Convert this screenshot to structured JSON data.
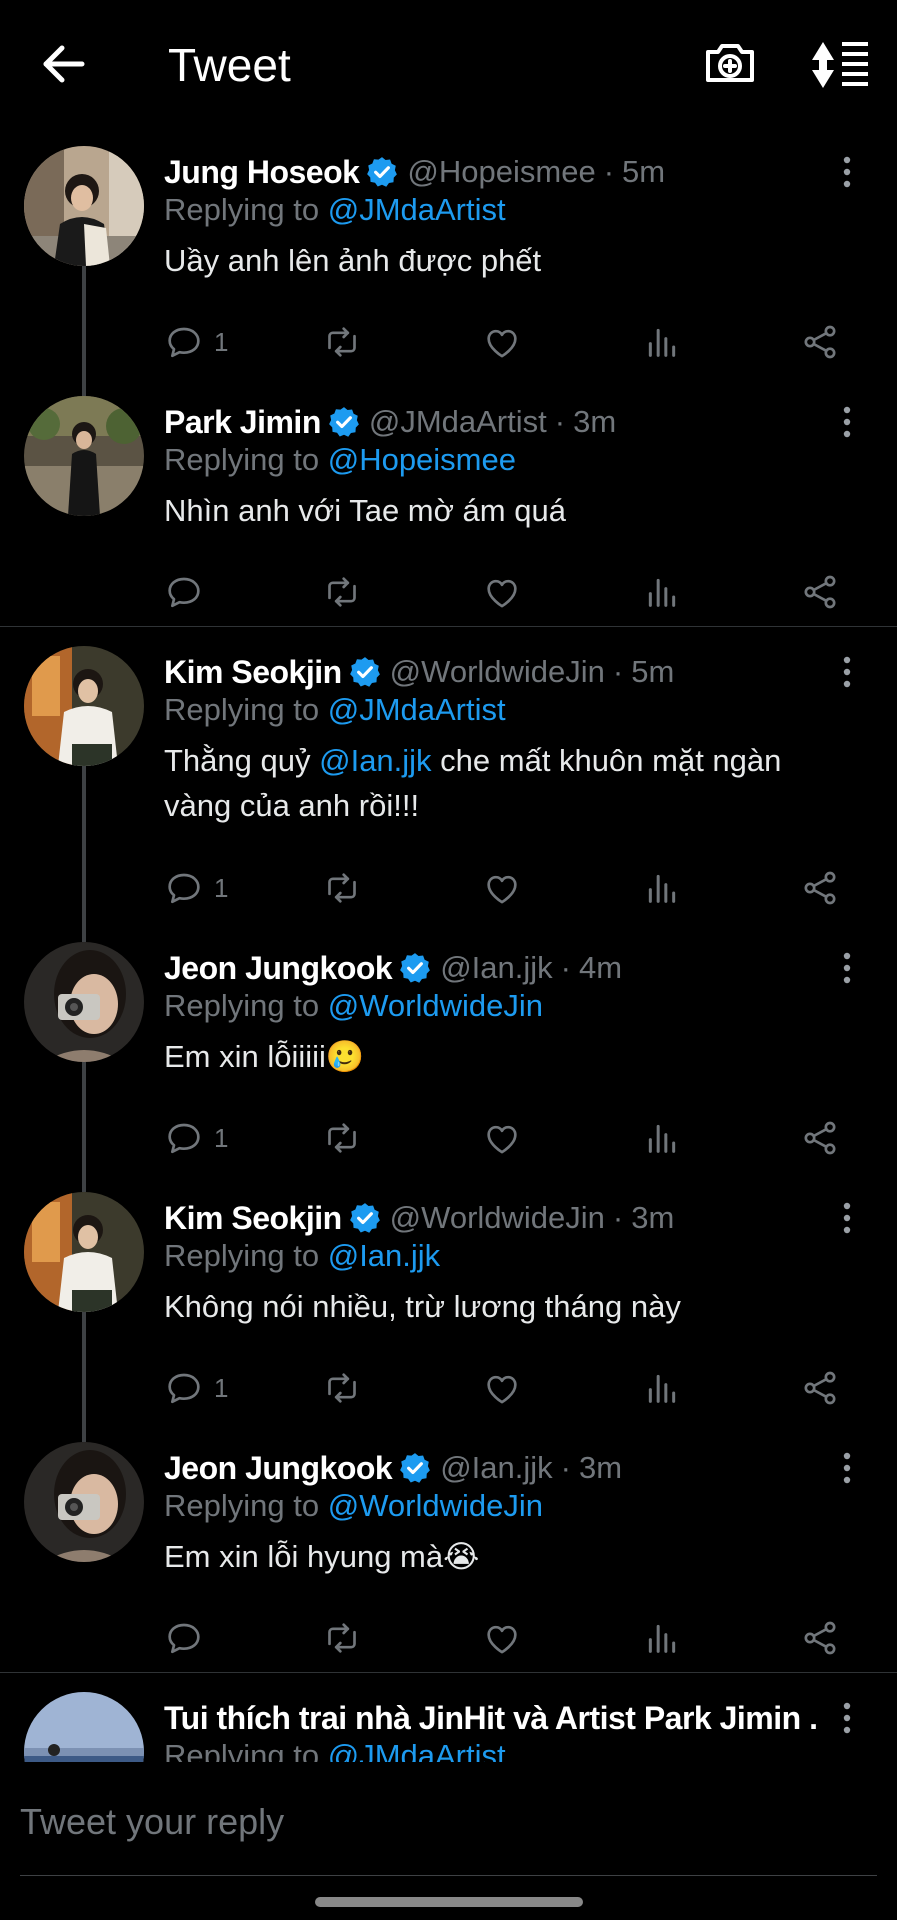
{
  "header": {
    "title": "Tweet"
  },
  "replying_label": "Replying to",
  "tweets": [
    {
      "name": "Jung Hoseok",
      "handle": "@Hopeismee",
      "dot": "·",
      "time": "5m",
      "replying_to": "@JMdaArtist",
      "text": "Uầy anh lên ảnh được phết",
      "reply_count": "1"
    },
    {
      "name": "Park Jimin",
      "handle": "@JMdaArtist",
      "dot": "·",
      "time": "3m",
      "replying_to": "@Hopeismee",
      "text": "Nhìn anh với Tae mờ ám quá",
      "reply_count": ""
    },
    {
      "name": "Kim Seokjin",
      "handle": "@WorldwideJin",
      "dot": "·",
      "time": "5m",
      "replying_to": "@JMdaArtist",
      "text_before": "Thằng quỷ ",
      "text_mention": "@Ian.jjk",
      "text_after": " che mất khuôn mặt ngàn vàng của anh rồi!!!",
      "reply_count": "1"
    },
    {
      "name": "Jeon Jungkook",
      "handle": "@Ian.jjk",
      "dot": "·",
      "time": "4m",
      "replying_to": "@WorldwideJin",
      "text": "Em xin lỗiiiii🥲",
      "reply_count": "1"
    },
    {
      "name": "Kim Seokjin",
      "handle": "@WorldwideJin",
      "dot": "·",
      "time": "3m",
      "replying_to": "@Ian.jjk",
      "text": "Không nói nhiều, trừ lương tháng này",
      "reply_count": "1"
    },
    {
      "name": "Jeon Jungkook",
      "handle": "@Ian.jjk",
      "dot": "·",
      "time": "3m",
      "replying_to": "@WorldwideJin",
      "text": "Em xin lỗi hyung mà😭",
      "reply_count": ""
    },
    {
      "name": "Tui thích trai nhà JinHit và Artist Park Jimin ...",
      "replying_to": "@JMdaArtist"
    }
  ],
  "reply_bar": {
    "placeholder": "Tweet your reply"
  },
  "colors": {
    "accent": "#1d9bf0",
    "muted": "#71767b",
    "background": "#000000"
  },
  "icons": [
    "back-arrow-icon",
    "camera-plus-icon",
    "sort-icon",
    "verified-badge-icon",
    "more-vertical-icon",
    "reply-icon",
    "retweet-icon",
    "like-icon",
    "views-icon",
    "share-icon"
  ]
}
